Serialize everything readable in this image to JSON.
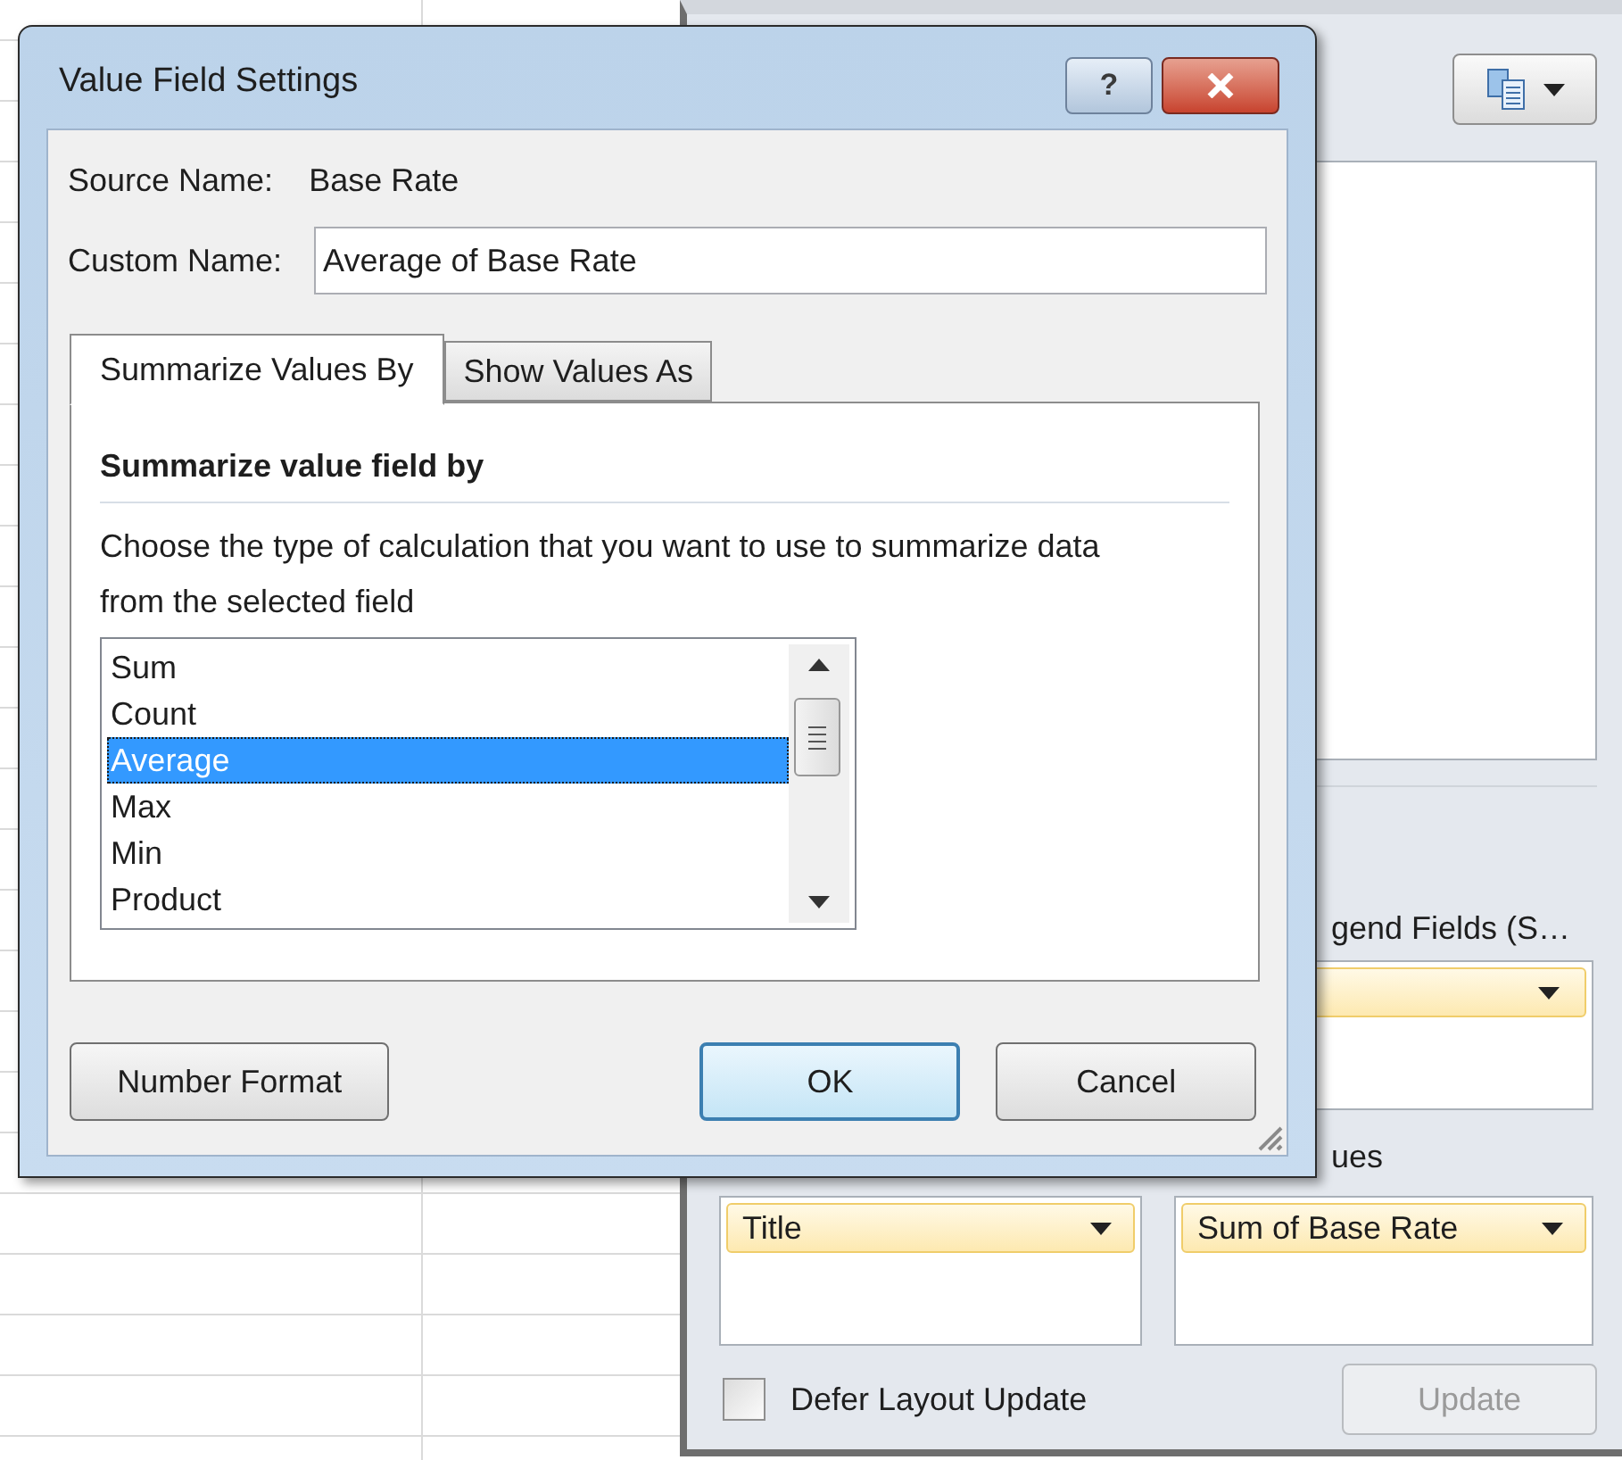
{
  "field_list": {
    "legend_fields_label": "gend Fields (S…",
    "values_label": "ues",
    "row_labels": [
      {
        "label": "Title"
      }
    ],
    "values": [
      {
        "label": "Sum of Base Rate"
      }
    ],
    "defer_layout_update": {
      "label": "Defer Layout Update",
      "checked": false
    },
    "update_button": {
      "label": "Update",
      "disabled": true
    }
  },
  "dialog": {
    "title": "Value Field Settings",
    "help_button": "?",
    "source_name_label": "Source Name:",
    "source_name": "Base Rate",
    "custom_name_label": "Custom Name:",
    "custom_name": "Average of Base Rate",
    "tabs": [
      {
        "label": "Summarize Values By",
        "selected": true
      },
      {
        "label": "Show Values As",
        "selected": false
      }
    ],
    "section_title": "Summarize value field by",
    "description": "Choose the type of calculation that you want to use to summarize data from the selected field",
    "functions": [
      {
        "label": "Sum",
        "selected": false
      },
      {
        "label": "Count",
        "selected": false
      },
      {
        "label": "Average",
        "selected": true
      },
      {
        "label": "Max",
        "selected": false
      },
      {
        "label": "Min",
        "selected": false
      },
      {
        "label": "Product",
        "selected": false
      }
    ],
    "buttons": [
      {
        "label": "Number Format",
        "kind": "secondary"
      },
      {
        "label": "OK",
        "kind": "default"
      },
      {
        "label": "Cancel",
        "kind": "normal"
      }
    ]
  }
}
